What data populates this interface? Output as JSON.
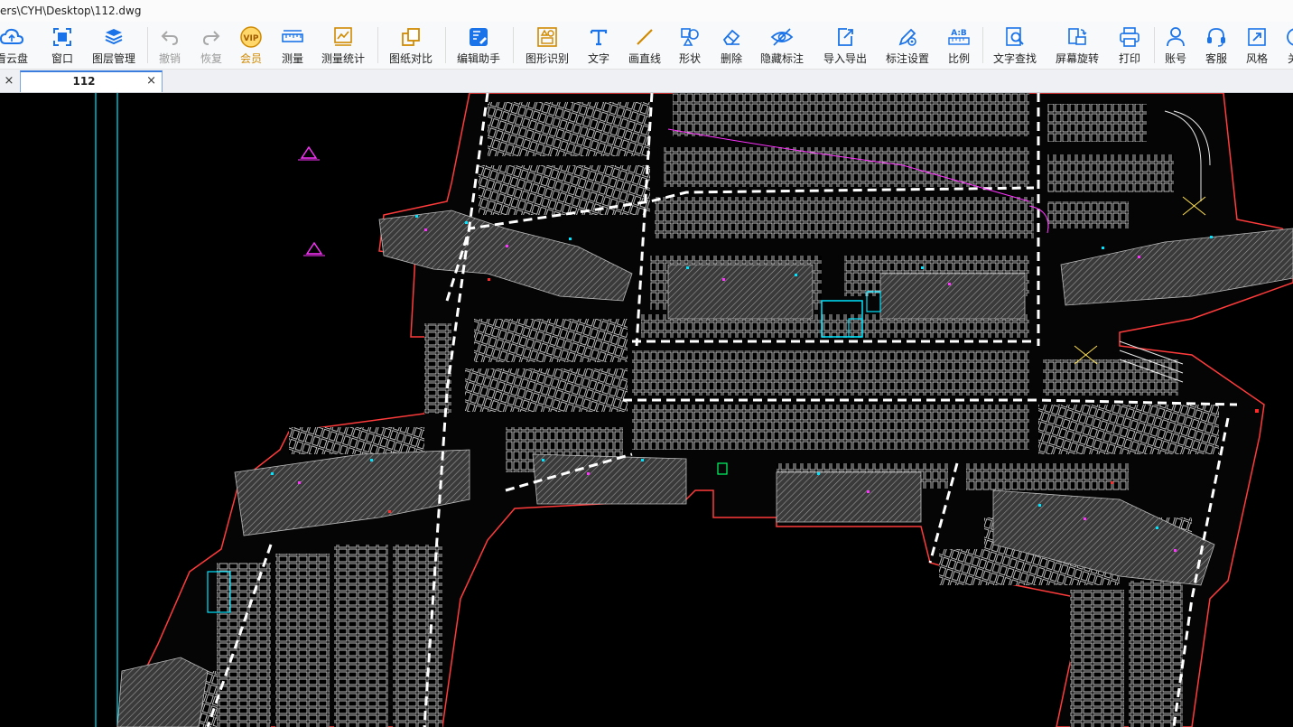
{
  "title_path": "ers\\CYH\\Desktop\\112.dwg",
  "toolbar": {
    "items": [
      {
        "label": "看云盘",
        "icon": "cloud-icon"
      },
      {
        "label": "窗口",
        "icon": "window-icon"
      },
      {
        "label": "图层管理",
        "icon": "layers-icon"
      },
      {
        "label": "撤销",
        "icon": "undo-icon"
      },
      {
        "label": "恢复",
        "icon": "redo-icon"
      },
      {
        "label": "会员",
        "icon": "vip-icon"
      },
      {
        "label": "测量",
        "icon": "ruler-icon"
      },
      {
        "label": "测量统计",
        "icon": "measure-stats-icon"
      },
      {
        "label": "图纸对比",
        "icon": "compare-icon"
      },
      {
        "label": "编辑助手",
        "icon": "edit-helper-icon"
      },
      {
        "label": "图形识别",
        "icon": "shape-recognition-icon"
      },
      {
        "label": "文字",
        "icon": "text-icon"
      },
      {
        "label": "画直线",
        "icon": "line-icon"
      },
      {
        "label": "形状",
        "icon": "shapes-icon"
      },
      {
        "label": "删除",
        "icon": "eraser-icon"
      },
      {
        "label": "隐藏标注",
        "icon": "hide-icon"
      },
      {
        "label": "导入导出",
        "icon": "import-export-icon"
      },
      {
        "label": "标注设置",
        "icon": "annotation-settings-icon"
      },
      {
        "label": "比例",
        "icon": "scale-icon"
      },
      {
        "label": "文字查找",
        "icon": "text-search-icon"
      },
      {
        "label": "屏幕旋转",
        "icon": "rotate-screen-icon"
      },
      {
        "label": "打印",
        "icon": "print-icon"
      },
      {
        "label": "账号",
        "icon": "account-icon"
      },
      {
        "label": "客服",
        "icon": "headset-icon"
      },
      {
        "label": "风格",
        "icon": "style-icon"
      },
      {
        "label": "关",
        "icon": "close-panel-icon"
      }
    ]
  },
  "tabs": {
    "close_glyph": "×",
    "active_title": "112"
  },
  "colors": {
    "accent": "#1a73e8",
    "vip": "#d08a00",
    "drawing_background": "#000000",
    "boundary": "#ff3b3b",
    "cyan": "#00e5ff",
    "magenta": "#ff33ff"
  }
}
